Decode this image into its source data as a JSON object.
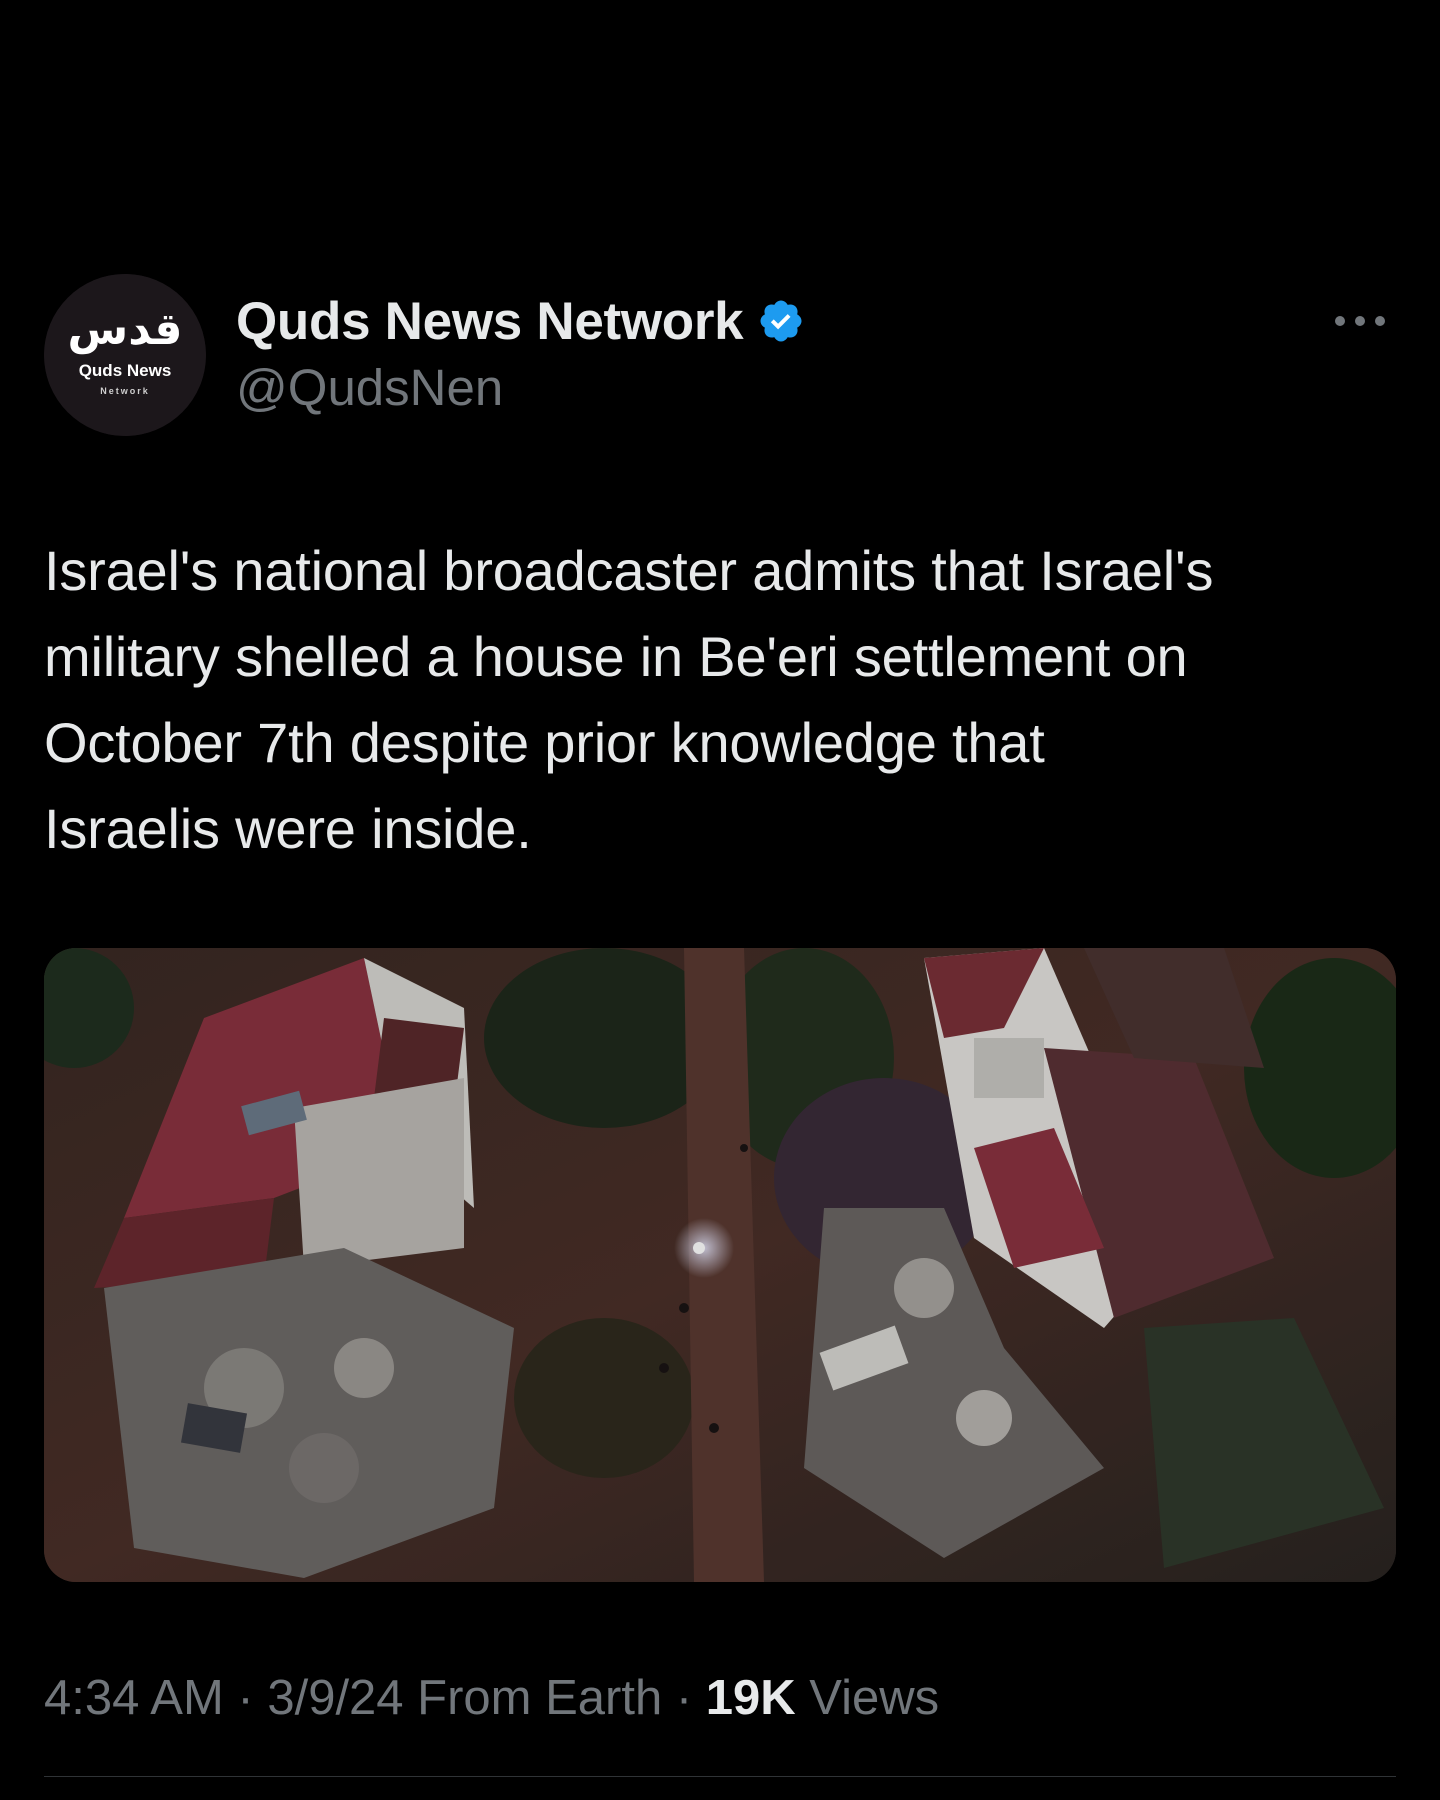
{
  "author": {
    "display_name": "Quds News Network",
    "handle": "@QudsNen",
    "verified": true,
    "avatar_logo_text": "قدس",
    "avatar_caption_1": "Quds News",
    "avatar_caption_2": "Network"
  },
  "tweet": {
    "text_lines": [
      "Israel's national broadcaster admits that Israel's",
      "military shelled a house in Be'eri settlement on",
      "October 7th despite prior knowledge that",
      "Israelis were inside."
    ],
    "image_icon": "aerial-photo-destroyed-houses"
  },
  "meta": {
    "time": "4:34 AM",
    "sep1": " · ",
    "date": "3/9/24",
    "source": " From Earth",
    "sep2": " · ",
    "views_count": "19K",
    "views_label": " Views"
  },
  "colors": {
    "background": "#000000",
    "text_primary": "#e7e9ea",
    "text_secondary": "#71767b",
    "verified_blue": "#1d9bf0",
    "divider": "#2f3336"
  },
  "icons": {
    "more": "more-horizontal-icon",
    "verified": "verified-badge-icon"
  }
}
